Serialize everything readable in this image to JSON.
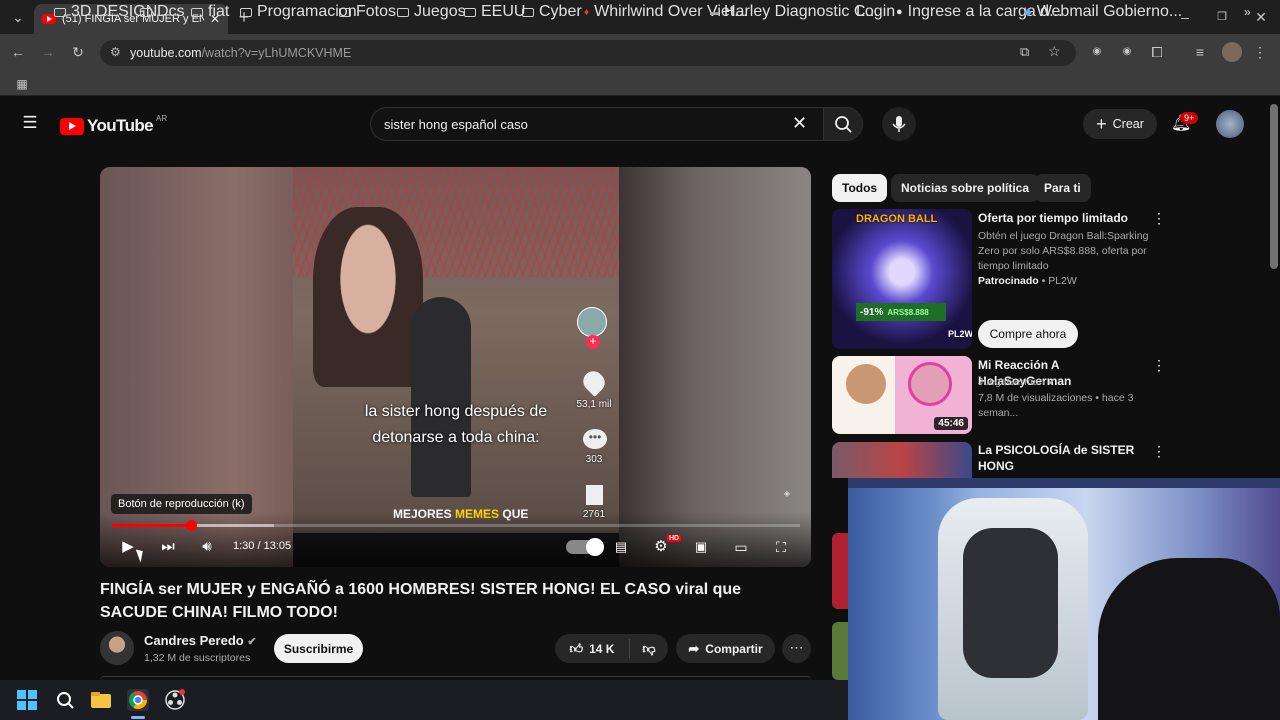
{
  "browser": {
    "tab_title": "(51) FINGÍA ser MUJER y ENGA",
    "url_domain": "youtube.com",
    "url_path": "/watch?v=yLhUMCKVHME",
    "bookmarks": [
      "3D DESIGN",
      "Dcs",
      "fiat",
      "Programacion",
      "Fotos",
      "Juegos",
      "EEUU",
      "Cyber",
      "Whirlwind Over Viet...",
      "Harley Diagnostic C...",
      "Login",
      "Ingrese a la carga d...",
      "Webmail Gobierno..."
    ]
  },
  "youtube": {
    "logo_text": "YouTube",
    "country": "AR",
    "search_value": "sister hong español caso",
    "create_label": "Crear",
    "notif_badge": "9+",
    "player": {
      "overlay_line1": "la sister hong después de",
      "overlay_line2": "detonarse a toda china:",
      "likes_count": "53,1 mil",
      "comments_count": "303",
      "saves_count": "2761",
      "memes_a": "MEJORES",
      "memes_b": "MEMES",
      "memes_c": "QUE",
      "tooltip": "Botón de reproducción (k)",
      "time": "1:30 / 13:05",
      "progress": 0.115,
      "buffered": 0.235,
      "hd_badge": "HD"
    },
    "video_title": "FINGÍA ser MUJER y ENGAÑÓ a 1600 HOMBRES! SISTER HONG! EL CASO viral que SACUDE CHINA! FILMO TODO!",
    "channel": "Candres Peredo",
    "subscribers": "1,32 M de suscriptores",
    "subscribe_label": "Suscribirme",
    "likes": "14 K",
    "share_label": "Compartir",
    "chips": [
      "Todos",
      "Noticias sobre política",
      "Para ti"
    ],
    "ad": {
      "title": "Oferta por tiempo limitado",
      "desc": "Obtén el juego Dragon Ball:Sparking Zero por solo ARS$8.888, oferta por tiempo limitado",
      "sponsored": "Patrocinado",
      "advertiser": "PL2W",
      "cta": "Compre ahora",
      "discount": "-91%",
      "price": "ARS$8.888"
    },
    "related": [
      {
        "title": "Mi Reacción A HolaSoyGerman",
        "channel": "JuegaGerman",
        "meta": "7,8 M de visualizaciones • hace 3 seman...",
        "duration": "45:46"
      },
      {
        "title": "La PSICOLOGÍA de SISTER HONG"
      }
    ]
  },
  "colors": {
    "yt_red": "#ff0000",
    "bg": "#0f0f0f",
    "chip": "#272727"
  }
}
